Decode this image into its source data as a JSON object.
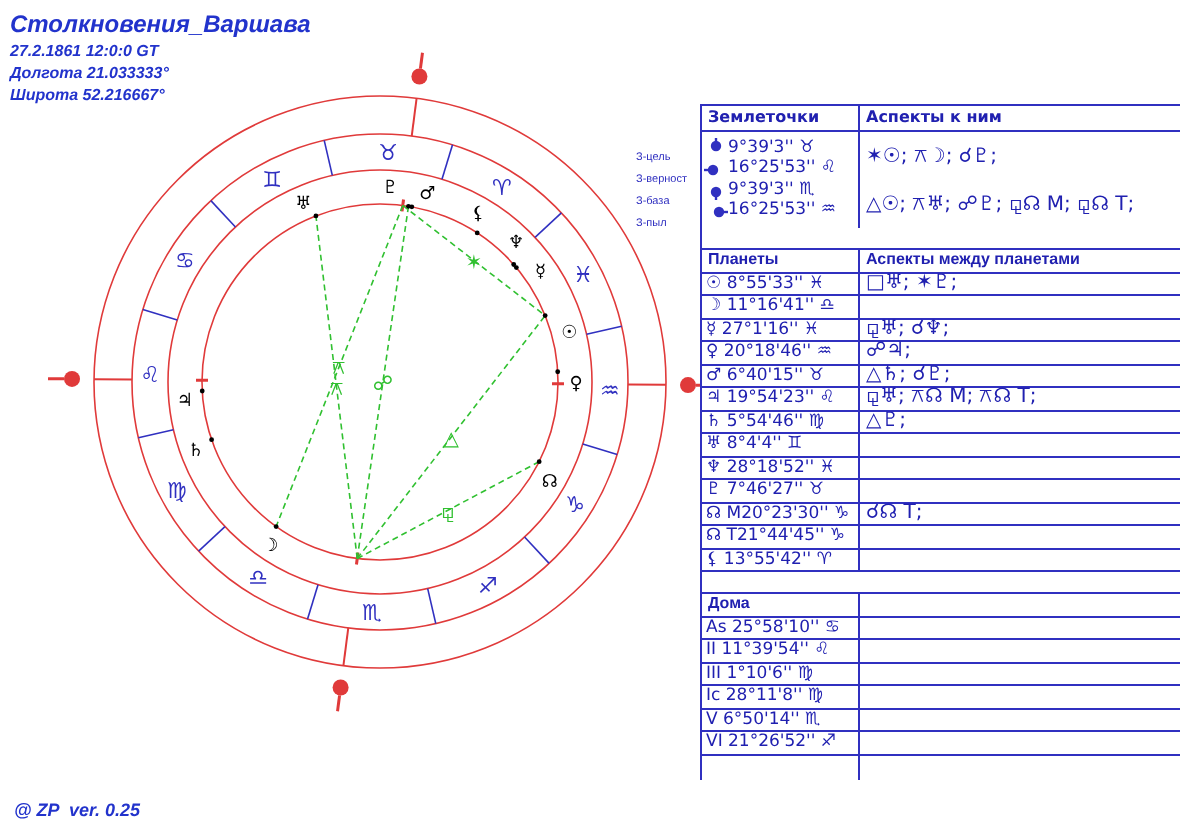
{
  "header": {
    "title": "Столкновения_Варшава",
    "lines": [
      "27.2.1861 12:0:0 GT",
      "Долгота 21.033333°",
      "Широта 52.216667°"
    ]
  },
  "wheel": {
    "signs": [
      "♈",
      "♉",
      "♊",
      "♋",
      "♌",
      "♍",
      "♎",
      "♏",
      "♐",
      "♑",
      "♒",
      "♓"
    ],
    "planets": [
      "☉",
      "☽",
      "☿",
      "♀",
      "♂",
      "♃",
      "♄",
      "♅",
      "♆",
      "♇",
      "☊",
      "⚸"
    ],
    "point_labels": [
      "З-цель",
      "З-верност",
      "З-база",
      "З-пыл"
    ],
    "aspect_marks": [
      "✶",
      "⚻",
      "△",
      "⚻",
      "☍",
      "⚼"
    ]
  },
  "earth_points": {
    "header": "Землеточки",
    "aspects_header": "Аспекты к ним",
    "values": [
      "9°39'3'' ♉",
      "16°25'53'' ♌",
      "9°39'3'' ♏",
      "16°25'53'' ♒"
    ],
    "aspects": [
      "✶☉; ⚻☽; ☌♇;",
      "△☉; ⚻♅; ☍♇; ⚼☊ M; ⚼☊ T;"
    ]
  },
  "planets": {
    "header": "Планеты",
    "aspects_header": "Аспекты между планетами",
    "rows": [
      {
        "position": "☉ 8°55'33'' ♓",
        "aspects": "□♅; ✶♇;"
      },
      {
        "position": "☽ 11°16'41'' ♎",
        "aspects": ""
      },
      {
        "position": "☿ 27°1'16'' ♓",
        "aspects": "⚼♅; ☌♆;"
      },
      {
        "position": "♀ 20°18'46'' ♒",
        "aspects": "☍♃;"
      },
      {
        "position": "♂ 6°40'15'' ♉",
        "aspects": "△♄; ☌♇;"
      },
      {
        "position": "♃ 19°54'23'' ♌",
        "aspects": "⚼♅; ⚻☊ M; ⚻☊ T;"
      },
      {
        "position": "♄ 5°54'46'' ♍",
        "aspects": "△♇;"
      },
      {
        "position": "♅ 8°4'4'' ♊",
        "aspects": ""
      },
      {
        "position": "♆ 28°18'52'' ♓",
        "aspects": ""
      },
      {
        "position": "♇ 7°46'27'' ♉",
        "aspects": ""
      },
      {
        "position": "☊ M20°23'30'' ♑",
        "aspects": "☌☊ T;"
      },
      {
        "position": "☊ T21°44'45'' ♑",
        "aspects": ""
      },
      {
        "position": "⚸ 13°55'42'' ♈",
        "aspects": ""
      }
    ]
  },
  "houses": {
    "header": "Дома",
    "rows": [
      "As 25°58'10'' ♋",
      "II 11°39'54'' ♌",
      "III 1°10'6'' ♍",
      "Ic 28°11'8'' ♍",
      "V 6°50'14'' ♏",
      "VI 21°26'52'' ♐"
    ]
  },
  "footer": "@ ZP  ver. 0.25"
}
